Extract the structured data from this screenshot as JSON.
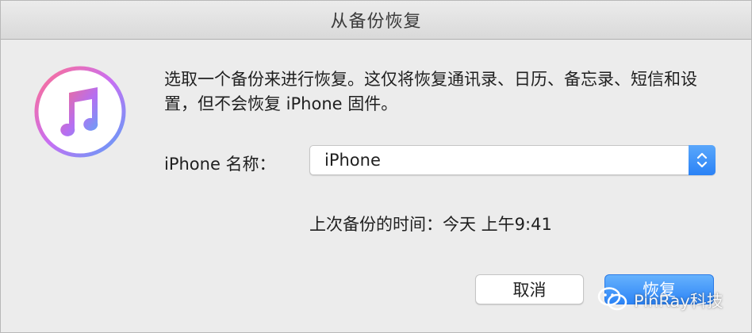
{
  "dialog": {
    "title": "从备份恢复",
    "message": "选取一个备份来进行恢复。这仅将恢复通讯录、日历、备忘录、短信和设置，但不会恢复 iPhone 固件。",
    "name_label": "iPhone 名称：",
    "selected_device": "iPhone",
    "backup_time": "上次备份的时间：今天 上午9:41",
    "cancel_label": "取消",
    "restore_label": "恢复"
  },
  "watermark": {
    "text": "PinRay科技"
  },
  "icons": {
    "app": "itunes-music-icon",
    "select": "up-down-chevron-icon",
    "watermark": "wechat-icon"
  },
  "colors": {
    "accent": "#2c84f6",
    "icon_gradient": [
      "#f36a8b",
      "#c86ff3",
      "#5a9df7"
    ]
  }
}
